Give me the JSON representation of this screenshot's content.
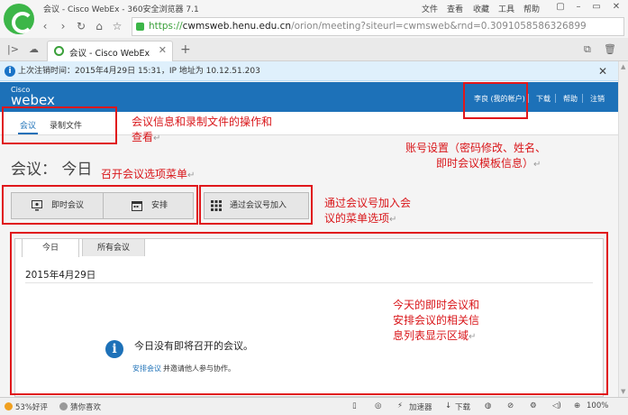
{
  "browser": {
    "window_title": "会议 - Cisco WebEx - 360安全浏览器 7.1",
    "menu": [
      "文件",
      "查看",
      "收藏",
      "工具",
      "帮助"
    ],
    "url": {
      "prefix": "https://",
      "domain": "cwmsweb.henu.edu.cn",
      "rest": "/orion/meeting?siteurl=cwmsweb&rnd=0.3091058586326899"
    },
    "tab_title": "会议 - Cisco WebEx",
    "infobar_text": "上次注销时间：2015年4月29日 15:31，IP 地址为 10.12.51.203"
  },
  "header": {
    "logo_top": "Cisco",
    "logo_main": "webex",
    "links": [
      "李良 (我的帐户)",
      "下载",
      "帮助",
      "注销"
    ]
  },
  "subnav": {
    "tabs": [
      "会议",
      "录制文件"
    ]
  },
  "page": {
    "title": "会议：  今日",
    "buttons": {
      "instant": "即时会议",
      "schedule": "安排",
      "join_by_number": "通过会议号加入"
    },
    "panel_tabs": [
      "今日",
      "所有会议"
    ],
    "date": "2015年4月29日",
    "empty_message": "今日没有即将召开的会议。",
    "schedule_link": "安排会议",
    "schedule_tail": "并邀请他人参与协作。"
  },
  "annotations": {
    "a1_line1": "会议信息和录制文件的操作和",
    "a1_line2": "查看",
    "a2_line1": "账号设置（密码修改、姓名、",
    "a2_line2": "即时会议模板信息）",
    "a3_line1": "召开会议选项菜单",
    "a4_line1": "通过会议号加入会",
    "a4_line2": "议的菜单选项",
    "a5_line1": "今天的即时会议和",
    "a5_line2": "安排会议的相关信",
    "a5_line3": "息列表显示区域",
    "mark": "↵",
    "color": "#e0171b"
  },
  "statusbar": {
    "rating": "53%好评",
    "guess": "猜你喜欢",
    "accelerator": "加速器",
    "download": "下载",
    "zoom": "100%"
  }
}
